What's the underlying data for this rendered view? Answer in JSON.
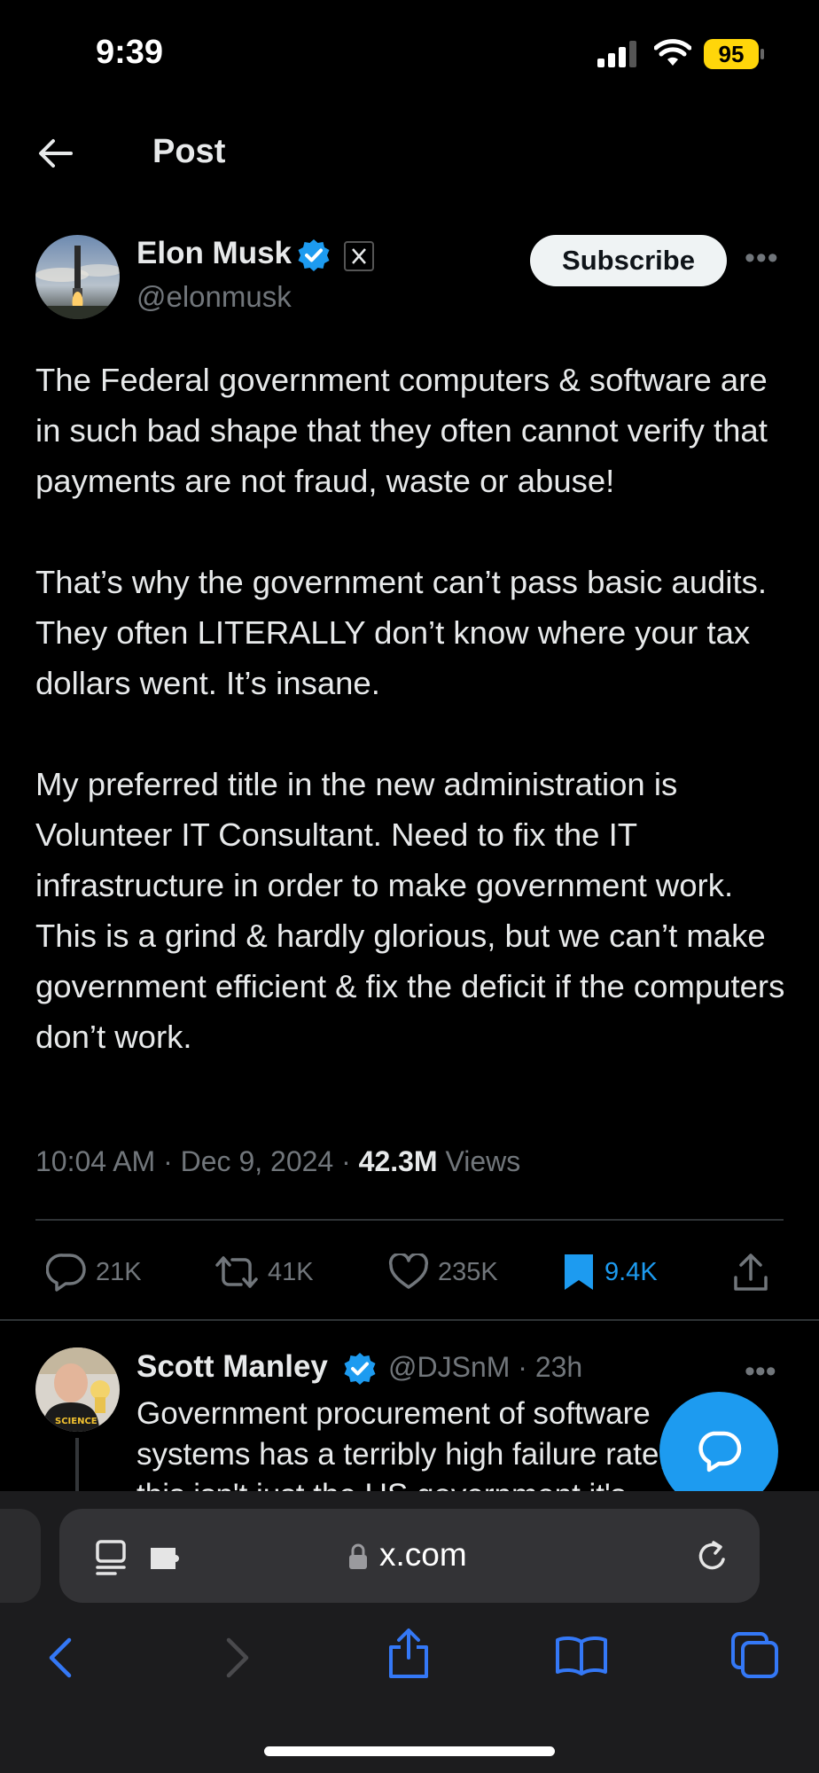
{
  "status_bar": {
    "time": "9:39",
    "battery": "95"
  },
  "header": {
    "title": "Post"
  },
  "post": {
    "author": {
      "name": "Elon Musk",
      "handle": "@elonmusk"
    },
    "subscribe_label": "Subscribe",
    "paragraphs": [
      "The Federal government computers & software are in such bad shape that they often cannot verify that payments are not fraud, waste or abuse!",
      "That’s why the government can’t pass basic audits. They often LITERALLY don’t know where your tax dollars went. It’s insane.",
      "My preferred title in the new administration is Volunteer IT Consultant. Need to fix the IT infrastructure in order to make government work. This is a grind & hardly glorious, but we can’t make government efficient & fix the deficit if the computers don’t work."
    ],
    "time": "10:04 AM",
    "date": "Dec 9, 2024",
    "views_count": "42.3M",
    "views_label": "Views",
    "actions": {
      "replies": "21K",
      "reposts": "41K",
      "likes": "235K",
      "bookmarks": "9.4K"
    }
  },
  "reply": {
    "name": "Scott Manley",
    "handle": "@DJSnM",
    "time": "23h",
    "text_lines": [
      "Government procurement of software",
      "systems has a terribly high failure rate,",
      "this isn't just the US government it's"
    ]
  },
  "browser": {
    "url": "x.com"
  },
  "colors": {
    "accent": "#1d9bf0",
    "background": "#000000",
    "battery": "#ffd60a"
  },
  "icons": [
    "back-arrow-icon",
    "verified-badge-icon",
    "x-affiliate-badge-icon",
    "reply-icon",
    "repost-icon",
    "like-icon",
    "bookmark-icon",
    "share-icon",
    "compose-reply-icon",
    "reader-icon",
    "extension-icon",
    "lock-icon",
    "reload-icon",
    "safari-back-icon",
    "safari-forward-icon",
    "safari-share-icon",
    "bookmarks-book-icon",
    "tabs-icon"
  ]
}
